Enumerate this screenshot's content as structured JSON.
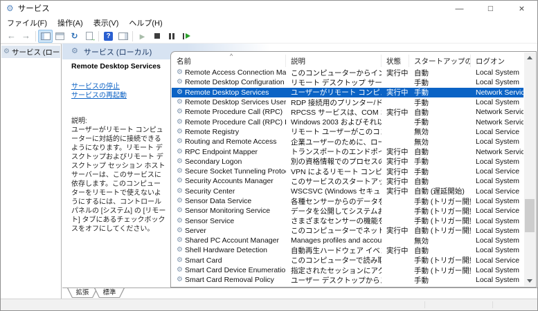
{
  "window": {
    "title": "サービス",
    "controls": {
      "minimize": "—",
      "maximize": "□",
      "close": "×"
    }
  },
  "menu": {
    "items": [
      "ファイル(F)",
      "操作(A)",
      "表示(V)",
      "ヘルプ(H)"
    ]
  },
  "toolbar": {
    "buttons": [
      {
        "icon": "back-arrow"
      },
      {
        "icon": "forward-arrow"
      },
      {
        "sep": true
      },
      {
        "icon": "console-tree",
        "active": true
      },
      {
        "icon": "properties-dialog"
      },
      {
        "icon": "refresh"
      },
      {
        "icon": "export-list"
      },
      {
        "sep": true
      },
      {
        "icon": "help"
      },
      {
        "icon": "action-pane"
      },
      {
        "sep": true
      },
      {
        "icon": "start-service"
      },
      {
        "icon": "stop-service"
      },
      {
        "icon": "pause-service"
      },
      {
        "icon": "restart-service"
      }
    ]
  },
  "tree": {
    "root": "サービス (ローカル)"
  },
  "detail": {
    "header": "サービス (ローカル)",
    "service_name": "Remote Desktop Services",
    "links": [
      "サービスの停止",
      "サービスの再起動"
    ],
    "description_label": "説明:",
    "description": "ユーザーがリモート コンピューターに対話的に接続できるようになります。リモート デスクトップおよびリモート デスクトップ セッション ホスト サーバーは、このサービスに依存します。このコンピューターをリモートで使えないようにするには、コントロール パネルの [システム] の [リモート] タブにあるチェックボックスをオフにしてください。"
  },
  "table": {
    "columns": [
      "名前",
      "説明",
      "状態",
      "スタートアップの種類",
      "ログオン"
    ],
    "sort_indicator": "^",
    "rows": [
      {
        "name": "Remote Access Connection Man...",
        "description": "このコンピューターからインターネット...",
        "status": "実行中",
        "startup": "自動",
        "logon": "Local System"
      },
      {
        "name": "Remote Desktop Configuration",
        "description": "リモート デスクトップ サービスとリモー...",
        "status": "",
        "startup": "手動",
        "logon": "Local System"
      },
      {
        "name": "Remote Desktop Services",
        "description": "ユーザーがリモート コンピューターに対...",
        "status": "実行中",
        "startup": "手動",
        "logon": "Network Service",
        "selected": true
      },
      {
        "name": "Remote Desktop Services UserMo...",
        "description": "RDP 接続用のプリンター/ドライブ/...",
        "status": "",
        "startup": "手動",
        "logon": "Local System"
      },
      {
        "name": "Remote Procedure Call (RPC)",
        "description": "RPCSS サービスは、COM および D...",
        "status": "実行中",
        "startup": "自動",
        "logon": "Network Service"
      },
      {
        "name": "Remote Procedure Call (RPC) Loc...",
        "description": "Windows 2003 およびそれ以前の...",
        "status": "",
        "startup": "手動",
        "logon": "Network Service"
      },
      {
        "name": "Remote Registry",
        "description": "リモート ユーザーがこのコンピューター...",
        "status": "",
        "startup": "無効",
        "logon": "Local Service"
      },
      {
        "name": "Routing and Remote Access",
        "description": "企業ユーザーのために、ローカル エリ...",
        "status": "",
        "startup": "無効",
        "logon": "Local System"
      },
      {
        "name": "RPC Endpoint Mapper",
        "description": "トランスポートのエンドポイントに対す...",
        "status": "実行中",
        "startup": "自動",
        "logon": "Network Service"
      },
      {
        "name": "Secondary Logon",
        "description": "別の資格情報でのプロセスの開始...",
        "status": "実行中",
        "startup": "手動",
        "logon": "Local System"
      },
      {
        "name": "Secure Socket Tunneling Protoco...",
        "description": "VPN によるリモート コンピューターへ...",
        "status": "実行中",
        "startup": "手動",
        "logon": "Local Service"
      },
      {
        "name": "Security Accounts Manager",
        "description": "このサービスのスタートアップで別の...",
        "status": "実行中",
        "startup": "自動",
        "logon": "Local System"
      },
      {
        "name": "Security Center",
        "description": "WSCSVC (Windows セキュリティ...",
        "status": "実行中",
        "startup": "自動 (遅延開始)",
        "logon": "Local Service"
      },
      {
        "name": "Sensor Data Service",
        "description": "各種センサーからのデータを配信",
        "status": "",
        "startup": "手動 (トリガー開始)",
        "logon": "Local System"
      },
      {
        "name": "Sensor Monitoring Service",
        "description": "データを公開してシステムおよびユー...",
        "status": "",
        "startup": "手動 (トリガー開始)",
        "logon": "Local Service"
      },
      {
        "name": "Sensor Service",
        "description": "さまざまなセンサーの機能を管理す...",
        "status": "",
        "startup": "手動 (トリガー開始)",
        "logon": "Local System"
      },
      {
        "name": "Server",
        "description": "このコンピューターでネットワークをと...",
        "status": "実行中",
        "startup": "自動 (トリガー開始)",
        "logon": "Local System"
      },
      {
        "name": "Shared PC Account Manager",
        "description": "Manages profiles and account...",
        "status": "",
        "startup": "無効",
        "logon": "Local System"
      },
      {
        "name": "Shell Hardware Detection",
        "description": "自動再生ハードウェア イベントの通...",
        "status": "実行中",
        "startup": "自動",
        "logon": "Local System"
      },
      {
        "name": "Smart Card",
        "description": "このコンピューターで読み取られたス...",
        "status": "",
        "startup": "手動 (トリガー開始)",
        "logon": "Local Service"
      },
      {
        "name": "Smart Card Device Enumeration S...",
        "description": "指定されたセッションにアクセスでき...",
        "status": "",
        "startup": "手動 (トリガー開始)",
        "logon": "Local System"
      },
      {
        "name": "Smart Card Removal Policy",
        "description": "ユーザー デスクトップからスマート カ...",
        "status": "",
        "startup": "手動",
        "logon": "Local System"
      }
    ]
  },
  "tabs": [
    "拡張",
    "標準"
  ],
  "colors": {
    "selection": "#0b63c5",
    "link": "#0b61c4",
    "band": "#d7e3f2",
    "help_icon": "#2a5fd0"
  }
}
